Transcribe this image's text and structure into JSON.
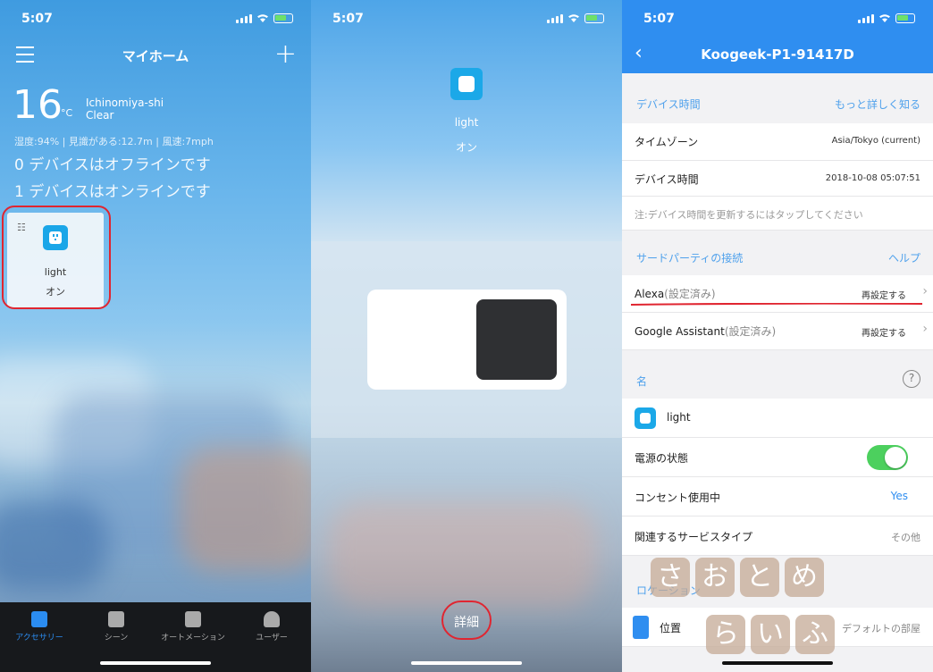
{
  "status_time": "5:07",
  "panel1": {
    "title": "マイホーム",
    "temperature": "16",
    "temp_unit": "°C",
    "city": "Ichinomiya-shi",
    "condition": "Clear",
    "weather_details": "湿度:94% | 見識がある:12.7m | 風速:7mph",
    "offline_line": "0 デバイスはオフラインです",
    "online_line": "1 デバイスはオンラインです",
    "device": {
      "name": "light",
      "state": "オン"
    },
    "tabs": [
      {
        "label": "アクセサリー",
        "active": true,
        "icon": "home-icon"
      },
      {
        "label": "シーン",
        "active": false,
        "icon": "grid-icon"
      },
      {
        "label": "オートメーション",
        "active": false,
        "icon": "automation-icon"
      },
      {
        "label": "ユーザー",
        "active": false,
        "icon": "user-icon"
      }
    ]
  },
  "panel2": {
    "device_name": "light",
    "device_state": "オン",
    "detail_label": "詳細"
  },
  "panel3": {
    "title": "Koogeek-P1-91417D",
    "section_device_time": {
      "label": "デバイス時間",
      "action": "もっと詳しく知る"
    },
    "timezone": {
      "label": "タイムゾーン",
      "value": "Asia/Tokyo (current)"
    },
    "device_time": {
      "label": "デバイス時間",
      "value": "2018-10-08 05:07:51"
    },
    "time_note": "注:デバイス時間を更新するにはタップしてください",
    "section_third_party": {
      "label": "サードパーティの接続",
      "action": "ヘルプ"
    },
    "alexa": {
      "label": "Alexa",
      "suffix": "(設定済み)",
      "action": "再設定する"
    },
    "google": {
      "label": "Google Assistant",
      "suffix": "(設定済み)",
      "action": "再設定する"
    },
    "section_name": {
      "label": "名",
      "help": "?"
    },
    "device_name": "light",
    "power": {
      "label": "電源の状態",
      "on": true
    },
    "outlet_in_use": {
      "label": "コンセント使用中",
      "value": "Yes"
    },
    "service_type": {
      "label": "関連するサービスタイプ",
      "value": "その他"
    },
    "section_location": {
      "label": "ロケーション"
    },
    "location": {
      "label": "位置",
      "value": "デフォルトの部屋"
    }
  },
  "watermark": {
    "row1": [
      "さ",
      "お",
      "と",
      "め"
    ],
    "row2": [
      "ら",
      "い",
      "ふ"
    ]
  },
  "colors": {
    "accent": "#2f8ef0",
    "switch_on": "#4cd05e",
    "annotation": "#e02530"
  }
}
